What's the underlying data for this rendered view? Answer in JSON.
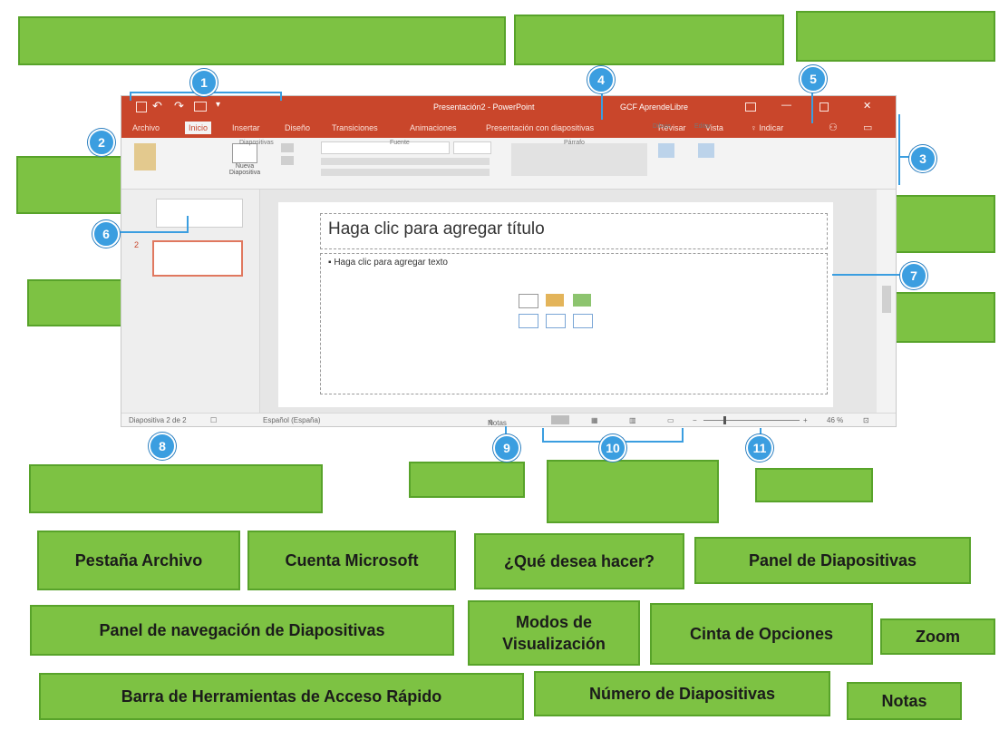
{
  "window": {
    "title": "Presentación2 - PowerPoint",
    "account": "GCF AprendeLibre",
    "tell_me": "Indicar",
    "tabs": [
      "Archivo",
      "Inicio",
      "Insertar",
      "Diseño",
      "Transiciones",
      "Animaciones",
      "Presentación con diapositivas",
      "Revisar",
      "Vista"
    ],
    "ribbon_groups": [
      "Diapositivas",
      "Fuente",
      "Párrafo",
      "Dibujo",
      "Editar"
    ],
    "new_slide_label": "Nueva Diapositiva",
    "slide_title_placeholder": "Haga clic para agregar título",
    "slide_body_placeholder": "Haga clic para agregar texto",
    "thumb_number": "2",
    "status_slide": "Diapositiva 2 de 2",
    "status_language": "Español (España)",
    "status_notes": "Notas",
    "zoom": "46 %"
  },
  "callouts": [
    "1",
    "2",
    "3",
    "4",
    "5",
    "6",
    "7",
    "8",
    "9",
    "10",
    "11"
  ],
  "labels": {
    "pestana_archivo": "Pestaña Archivo",
    "cuenta_microsoft": "Cuenta Microsoft",
    "que_desea_hacer": "¿Qué desea hacer?",
    "panel_diapositivas": "Panel de Diapositivas",
    "panel_navegacion": "Panel de navegación de Diapositivas",
    "modos_visualizacion": "Modos de Visualización",
    "cinta_opciones": "Cinta de Opciones",
    "zoom": "Zoom",
    "barra_herramientas": "Barra de Herramientas de Acceso Rápido",
    "numero_diapositivas": "Número de Diapositivas",
    "notas": "Notas"
  },
  "colors": {
    "title_bar": "#c9462b",
    "drop_zone": "#7dc243",
    "badge": "#3b9ee0"
  }
}
